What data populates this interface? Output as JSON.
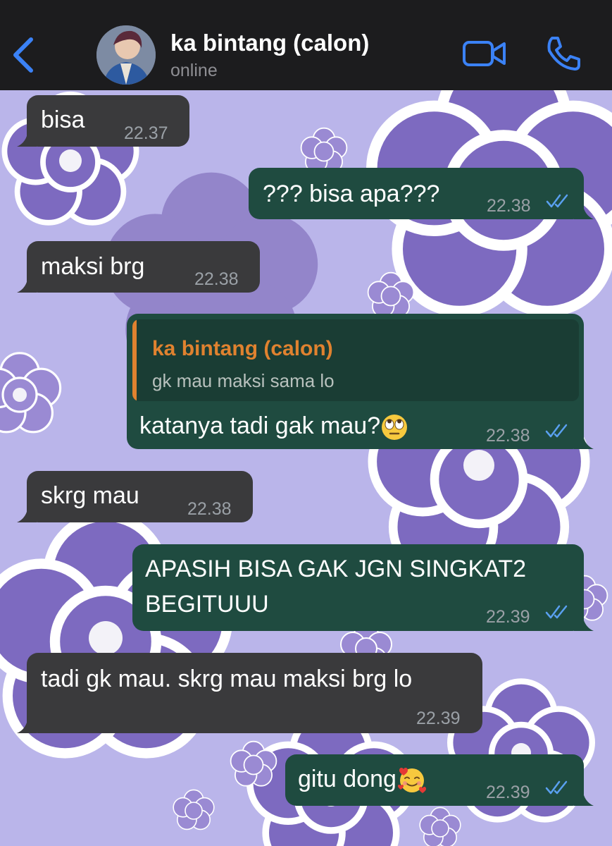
{
  "header": {
    "contact_name": "ka bintang (calon)",
    "status": "online",
    "back_icon": "chevron-left-icon",
    "video_icon": "video-camera-icon",
    "call_icon": "phone-icon"
  },
  "colors": {
    "header_bg": "#1c1c1e",
    "accent_blue": "#3b82f6",
    "incoming_bubble": "#3a3a3c",
    "outgoing_bubble": "#1f4b40",
    "quote_accent": "#e0822f",
    "wallpaper": "#b9b4ea"
  },
  "messages": [
    {
      "direction": "incoming",
      "text": "bisa",
      "time": "22.37"
    },
    {
      "direction": "outgoing",
      "text": "??? bisa apa???",
      "time": "22.38",
      "read": true
    },
    {
      "direction": "incoming",
      "text": "maksi brg",
      "time": "22.38"
    },
    {
      "direction": "outgoing",
      "reply_to": {
        "name": "ka bintang (calon)",
        "text": "gk mau maksi sama lo"
      },
      "text": "katanya tadi gak mau?",
      "emoji": "face-with-rolling-eyes",
      "time": "22.38",
      "read": true
    },
    {
      "direction": "incoming",
      "text": "skrg mau",
      "time": "22.38"
    },
    {
      "direction": "outgoing",
      "text_line1": "APASIH BISA GAK JGN SINGKAT2",
      "text_line2": "BEGITUUU",
      "time": "22.39",
      "read": true
    },
    {
      "direction": "incoming",
      "text": "tadi gk mau. skrg mau maksi brg lo",
      "time": "22.39"
    },
    {
      "direction": "outgoing",
      "text": "gitu dong",
      "emoji": "smiling-face-with-hearts",
      "time": "22.39",
      "read": true
    }
  ]
}
